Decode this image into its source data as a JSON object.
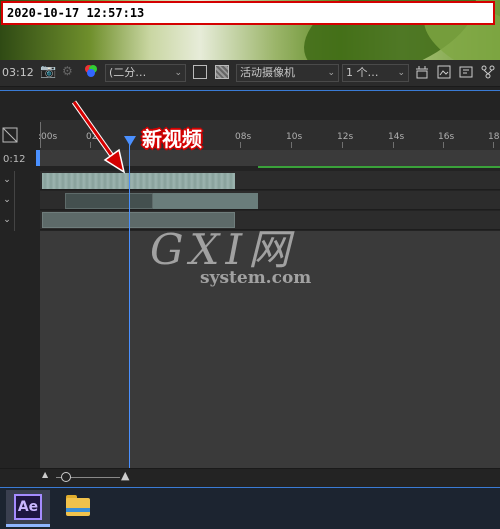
{
  "timestamp": "2020-10-17 12:57:13",
  "toolbar": {
    "timecode": "03:12",
    "resolution_select": "(二分…",
    "camera_select": "活动摄像机",
    "views_select": "1 个…"
  },
  "timeline": {
    "left_timecode": "0:12",
    "ruler_ticks": [
      ":00s",
      "02",
      "",
      "08s",
      "10s",
      "12s",
      "14s",
      "16s",
      "18"
    ]
  },
  "annotation": {
    "label": "新视频",
    "arrow_color": "#d40000"
  },
  "watermark": {
    "main": "GXI网",
    "sub": "system.com"
  },
  "taskbar": {
    "ae_label": "Ae"
  },
  "colors": {
    "playhead": "#4a90ff",
    "work_area": "#3aa23a",
    "timestamp_border": "#d40000"
  }
}
